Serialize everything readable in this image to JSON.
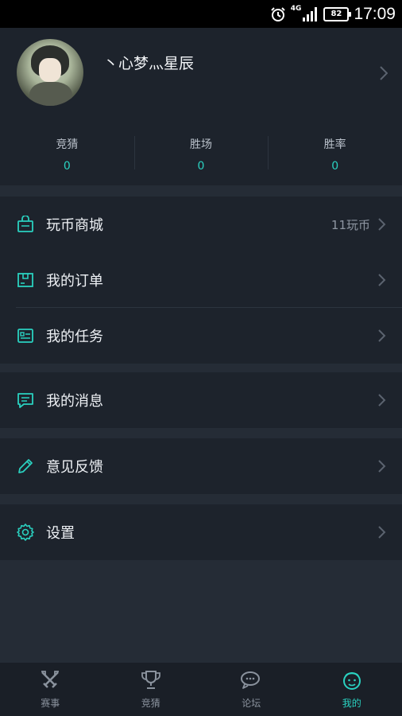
{
  "statusbar": {
    "network": "4G",
    "battery": "82",
    "time": "17:09"
  },
  "profile": {
    "username": "丶心梦灬星辰",
    "stats": [
      {
        "label": "竞猜",
        "value": "0"
      },
      {
        "label": "胜场",
        "value": "0"
      },
      {
        "label": "胜率",
        "value": "0"
      }
    ]
  },
  "menu": {
    "group1": [
      {
        "label": "玩币商城",
        "extra": "11玩币",
        "icon": "shopping-bag-icon"
      },
      {
        "label": "我的订单",
        "icon": "order-icon"
      },
      {
        "label": "我的任务",
        "icon": "task-card-icon"
      }
    ],
    "group2": [
      {
        "label": "我的消息",
        "icon": "message-icon"
      }
    ],
    "group3": [
      {
        "label": "意见反馈",
        "icon": "pencil-icon"
      }
    ],
    "group4": [
      {
        "label": "设置",
        "icon": "gear-icon"
      }
    ]
  },
  "bottomnav": {
    "items": [
      {
        "label": "赛事",
        "icon": "crossed-swords-icon"
      },
      {
        "label": "竞猜",
        "icon": "trophy-icon"
      },
      {
        "label": "论坛",
        "icon": "chat-icon"
      },
      {
        "label": "我的",
        "icon": "user-face-icon",
        "active": true
      }
    ]
  },
  "colors": {
    "accent": "#2ad1c0",
    "background": "#252c36",
    "card": "#1d232c"
  }
}
